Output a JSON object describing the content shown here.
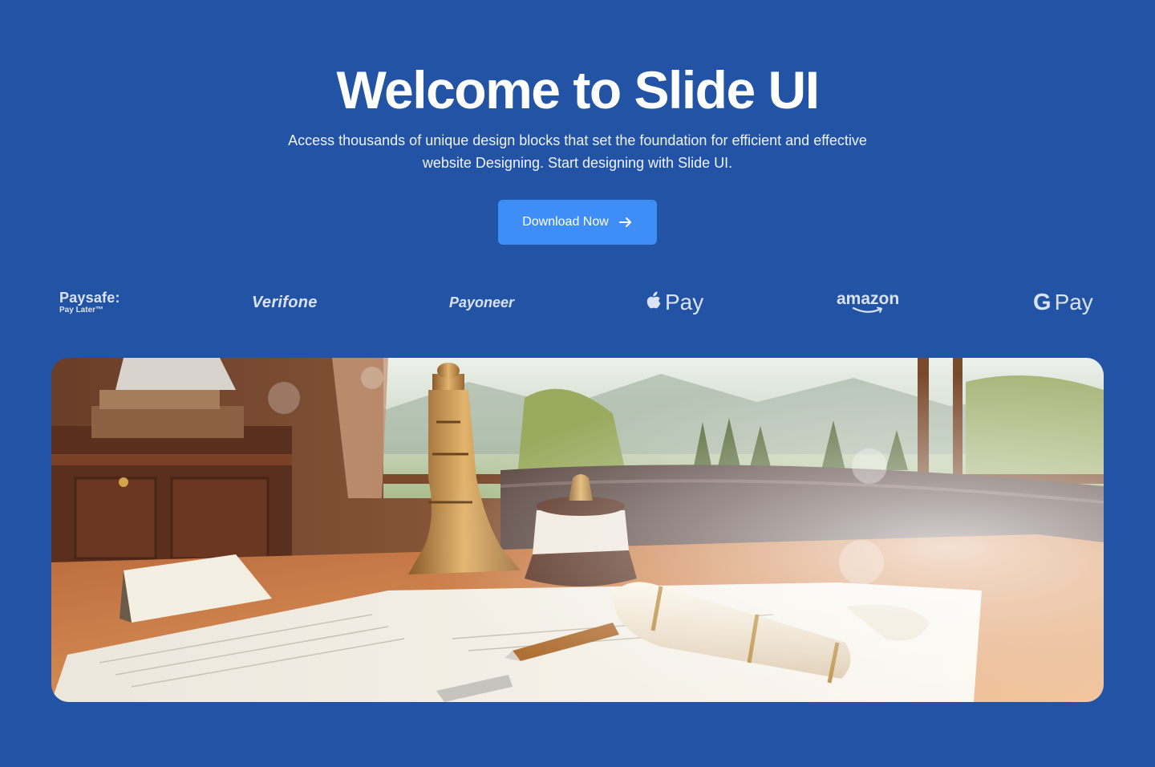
{
  "hero": {
    "title": "Welcome to Slide UI",
    "subtitle": "Access thousands of unique design blocks that set the foundation for efficient and effective website Designing. Start designing with Slide UI.",
    "cta_label": "Download Now",
    "cta_icon": "arrow-right-icon"
  },
  "logos": {
    "paysafe_main": "Paysafe:",
    "paysafe_sub": "Pay Later™",
    "verifone": "Verifone",
    "payoneer": "Payoneer",
    "applepay": "Pay",
    "amazon": "amazon",
    "gpay": "Pay",
    "gpay_g": "G"
  },
  "colors": {
    "background": "#2353a4",
    "button": "#3f8ef7",
    "logo": "#d9e3f5"
  }
}
